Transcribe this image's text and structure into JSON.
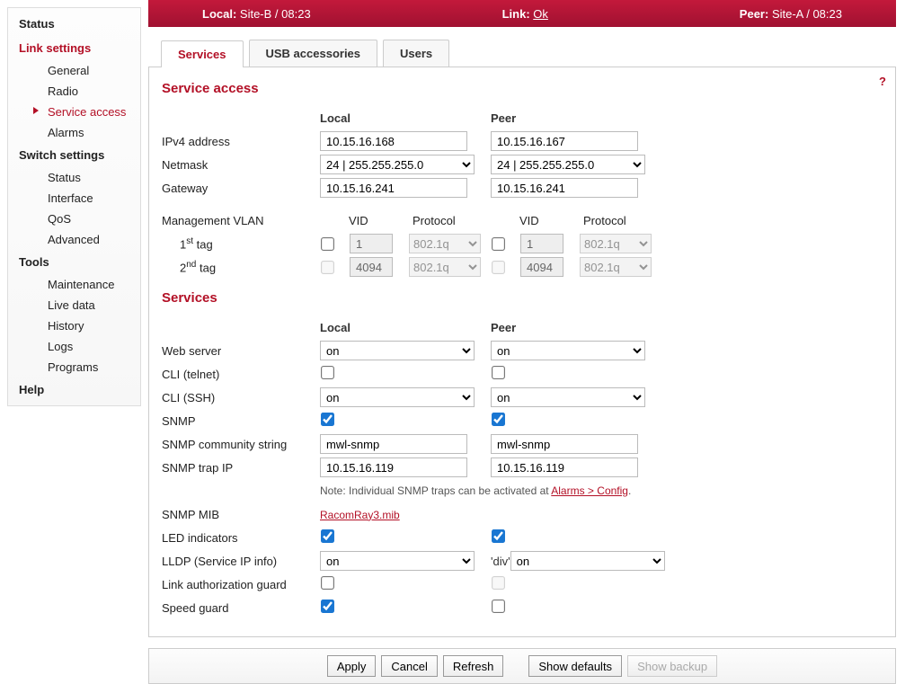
{
  "sidebar": {
    "status": "Status",
    "link_settings": "Link settings",
    "ls": {
      "general": "General",
      "radio": "Radio",
      "service_access": "Service access",
      "alarms": "Alarms"
    },
    "switch_settings": "Switch settings",
    "sw": {
      "status": "Status",
      "interface": "Interface",
      "qos": "QoS",
      "advanced": "Advanced"
    },
    "tools": "Tools",
    "tl": {
      "maintenance": "Maintenance",
      "live": "Live data",
      "history": "History",
      "logs": "Logs",
      "programs": "Programs"
    },
    "help": "Help"
  },
  "topbar": {
    "local_label": "Local: ",
    "local_value": "Site-B / 08:23",
    "link_label": "Link: ",
    "link_value": "Ok",
    "peer_label": "Peer: ",
    "peer_value": "Site-A / 08:23"
  },
  "tabs": {
    "services": "Services",
    "usb": "USB accessories",
    "users": "Users"
  },
  "help_icon": "?",
  "section": {
    "service_access": "Service access",
    "services": "Services"
  },
  "headers": {
    "local": "Local",
    "peer": "Peer",
    "vid": "VID",
    "protocol": "Protocol"
  },
  "labels": {
    "ipv4": "IPv4 address",
    "netmask": "Netmask",
    "gateway": "Gateway",
    "mgmt_vlan": "Management VLAN",
    "tag1_pre": "1",
    "tag1_post": " tag",
    "tag2_pre": "2",
    "tag2_post": " tag",
    "webserver": "Web server",
    "cli_telnet": "CLI (telnet)",
    "cli_ssh": "CLI (SSH)",
    "snmp": "SNMP",
    "snmp_comm": "SNMP community string",
    "snmp_trap": "SNMP trap IP",
    "snmp_note_pre": "Note: Individual SNMP traps can be activated at ",
    "snmp_note_link": "Alarms > Config",
    "snmp_note_post": ".",
    "snmp_mib": "SNMP MIB",
    "mib_link": "RacomRay3.mib",
    "led": "LED indicators",
    "lldp": "LLDP (Service IP info)",
    "linkauth": "Link authorization guard",
    "speed": "Speed guard"
  },
  "values": {
    "local": {
      "ipv4": "10.15.16.168",
      "netmask": "24   |   255.255.255.0",
      "gateway": "10.15.16.241",
      "tag1_vid": "1",
      "tag1_proto": "802.1q",
      "tag2_vid": "4094",
      "tag2_proto": "802.1q",
      "webserver": "on",
      "cli_ssh": "on",
      "snmp_comm": "mwl-snmp",
      "snmp_trap": "10.15.16.119",
      "lldp": "on"
    },
    "peer": {
      "ipv4": "10.15.16.167",
      "netmask": "24   |   255.255.255.0",
      "gateway": "10.15.16.241",
      "tag1_vid": "1",
      "tag1_proto": "802.1q",
      "tag2_vid": "4094",
      "tag2_proto": "802.1q",
      "webserver": "on",
      "cli_ssh": "on",
      "snmp_comm": "mwl-snmp",
      "snmp_trap": "10.15.16.119",
      "lldp": "on"
    }
  },
  "checkboxes": {
    "local": {
      "tag1": false,
      "tag2_enabled": false,
      "cli_telnet": false,
      "snmp": true,
      "led": true,
      "linkauth": false,
      "speed": true
    },
    "peer": {
      "tag1": false,
      "tag2_enabled": false,
      "cli_telnet": false,
      "snmp": true,
      "led": true,
      "linkauth_enabled": false,
      "speed": false
    }
  },
  "buttons": {
    "apply": "Apply",
    "cancel": "Cancel",
    "refresh": "Refresh",
    "show_defaults": "Show defaults",
    "show_backup": "Show backup"
  }
}
